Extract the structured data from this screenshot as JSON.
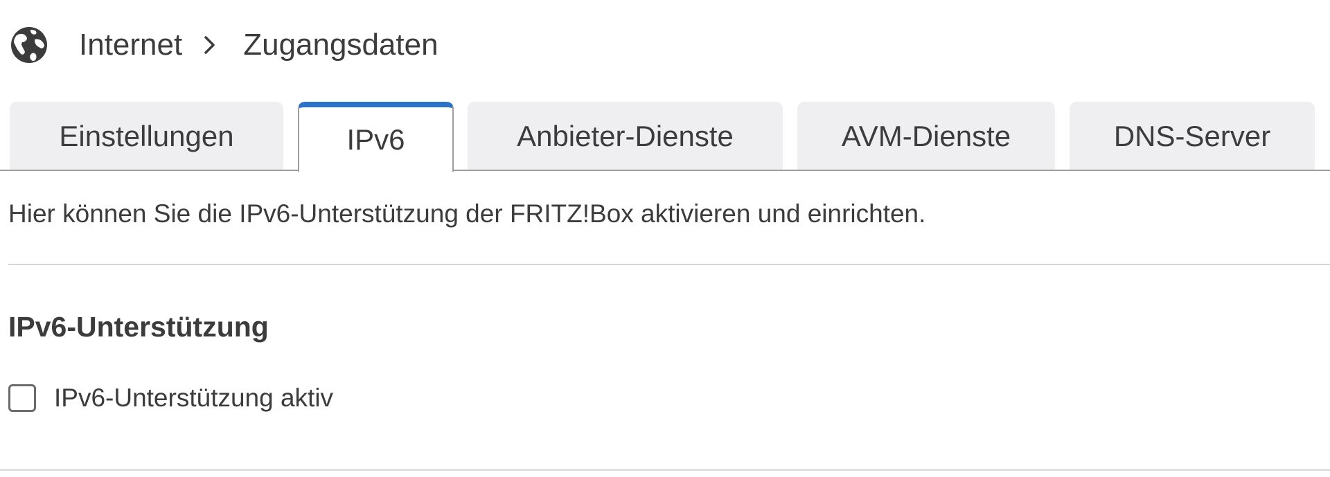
{
  "breadcrumb": {
    "icon": "globe-icon",
    "root": "Internet",
    "separator_icon": "chevron-right-icon",
    "current": "Zugangsdaten"
  },
  "tabs": [
    {
      "label": "Einstellungen",
      "active": false
    },
    {
      "label": "IPv6",
      "active": true
    },
    {
      "label": "Anbieter-Dienste",
      "active": false
    },
    {
      "label": "AVM-Dienste",
      "active": false
    },
    {
      "label": "DNS-Server",
      "active": false
    }
  ],
  "description": "Hier können Sie die IPv6-Unterstützung der FRITZ!Box aktivieren und einrichten.",
  "section": {
    "title": "IPv6-Unterstützung",
    "checkbox": {
      "label": "IPv6-Unterstützung aktiv",
      "checked": false
    }
  },
  "colors": {
    "active_tab_accent": "#2a72c8",
    "tab_background": "#efeff1",
    "text": "#3c3c3c"
  }
}
